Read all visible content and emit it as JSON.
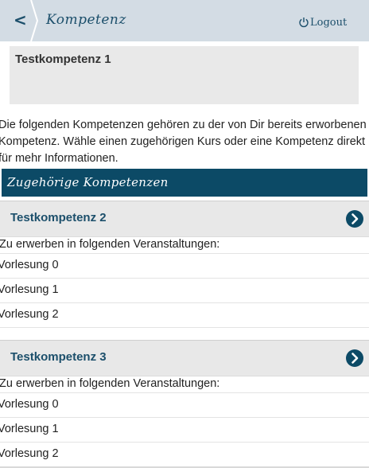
{
  "header": {
    "back_icon": "chevron-left-icon",
    "title": "Kompetenz",
    "logout_label": "Logout",
    "logout_icon": "power-icon"
  },
  "competence": {
    "title": "Testkompetenz 1"
  },
  "description": "Die folgenden Kompetenzen gehören zu der von Dir bereits erworbenen Kompetenz. Wähle einen zugehörigen Kurs oder eine Kompetenz direkt für mehr Informationen.",
  "section": {
    "title": "Zugehörige Kompetenzen"
  },
  "groups": [
    {
      "title": "Testkompetenz 2",
      "subtitle": "Zu erwerben in folgenden Veranstaltungen:",
      "courses": [
        "Vorlesung 0",
        "Vorlesung 1",
        "Vorlesung 2"
      ]
    },
    {
      "title": "Testkompetenz 3",
      "subtitle": "Zu erwerben in folgenden Veranstaltungen:",
      "courses": [
        "Vorlesung 0",
        "Vorlesung 1",
        "Vorlesung 2"
      ]
    }
  ],
  "colors": {
    "header_bg": "#d3dce4",
    "accent": "#1c4f6b",
    "section_bg": "#0c4a66"
  }
}
